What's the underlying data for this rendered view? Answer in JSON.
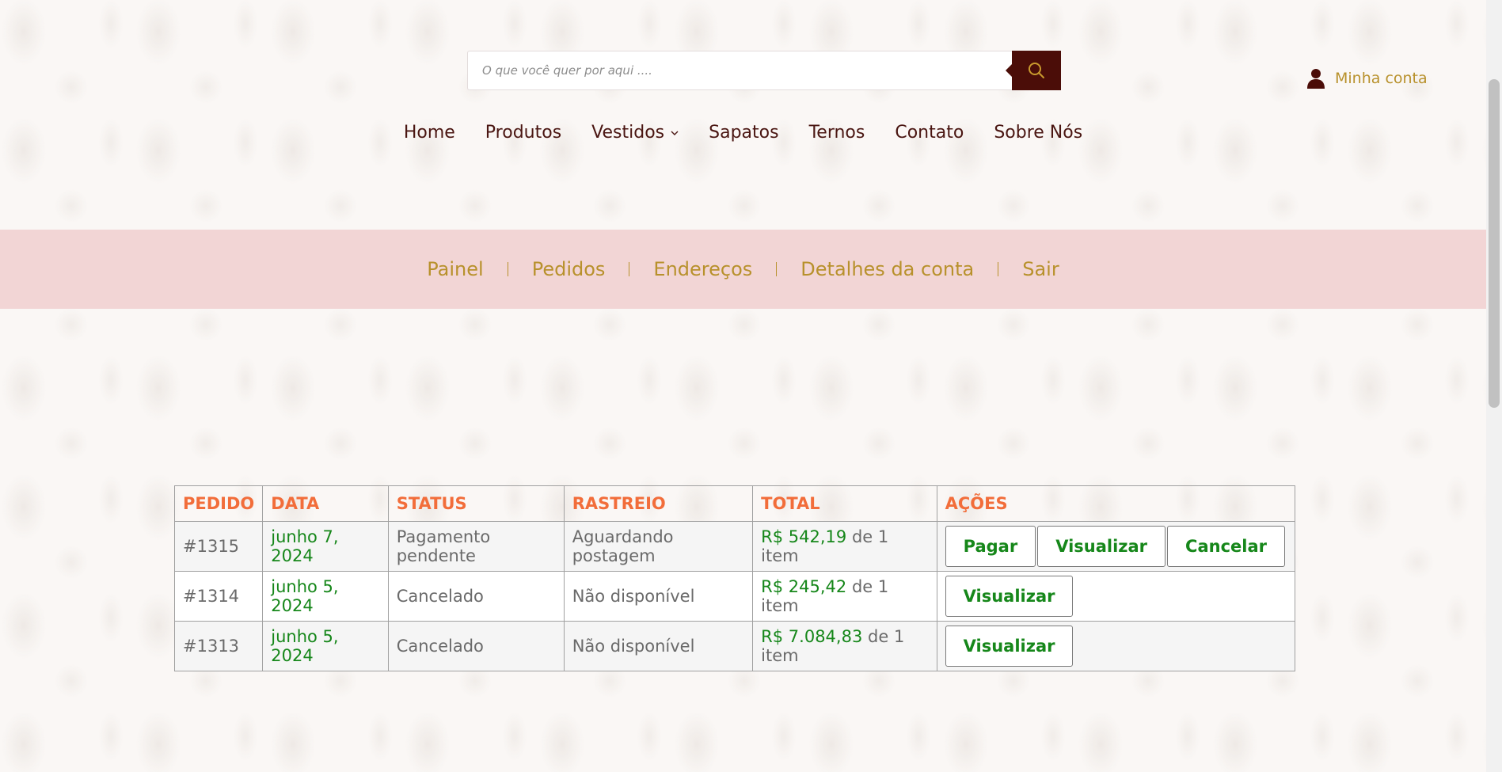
{
  "header": {
    "search_placeholder": "O que você quer por aqui ....",
    "account_label": "Minha conta"
  },
  "main_nav": [
    {
      "label": "Home"
    },
    {
      "label": "Produtos"
    },
    {
      "label": "Vestidos",
      "has_dropdown": true
    },
    {
      "label": "Sapatos"
    },
    {
      "label": "Ternos"
    },
    {
      "label": "Contato"
    },
    {
      "label": "Sobre Nós"
    }
  ],
  "account_nav": [
    {
      "label": "Painel"
    },
    {
      "label": "Pedidos"
    },
    {
      "label": "Endereços"
    },
    {
      "label": "Detalhes da conta"
    },
    {
      "label": "Sair"
    }
  ],
  "orders_table": {
    "headers": [
      "PEDIDO",
      "DATA",
      "STATUS",
      "RASTREIO",
      "TOTAL",
      "AÇÕES"
    ],
    "rows": [
      {
        "id": "#1315",
        "date": "junho 7, 2024",
        "status": "Pagamento pendente",
        "tracking": "Aguardando postagem",
        "price": "R$ 542,19",
        "qty": "de 1 item",
        "actions": [
          "Pagar",
          "Visualizar",
          "Cancelar"
        ]
      },
      {
        "id": "#1314",
        "date": "junho 5, 2024",
        "status": "Cancelado",
        "tracking": "Não disponível",
        "price": "R$ 245,42",
        "qty": "de 1 item",
        "actions": [
          "Visualizar"
        ]
      },
      {
        "id": "#1313",
        "date": "junho 5, 2024",
        "status": "Cancelado",
        "tracking": "Não disponível",
        "price": "R$ 7.084,83",
        "qty": "de 1 item",
        "actions": [
          "Visualizar"
        ]
      }
    ]
  },
  "colors": {
    "brand_dark": "#4b0d08",
    "gold": "#b8912c",
    "header_orange": "#f26d3a",
    "green": "#16871a",
    "account_bar_bg": "#f2d5d5"
  },
  "icons": {
    "search": "search-icon",
    "account": "user-icon",
    "dropdown": "chevron-down-icon"
  }
}
